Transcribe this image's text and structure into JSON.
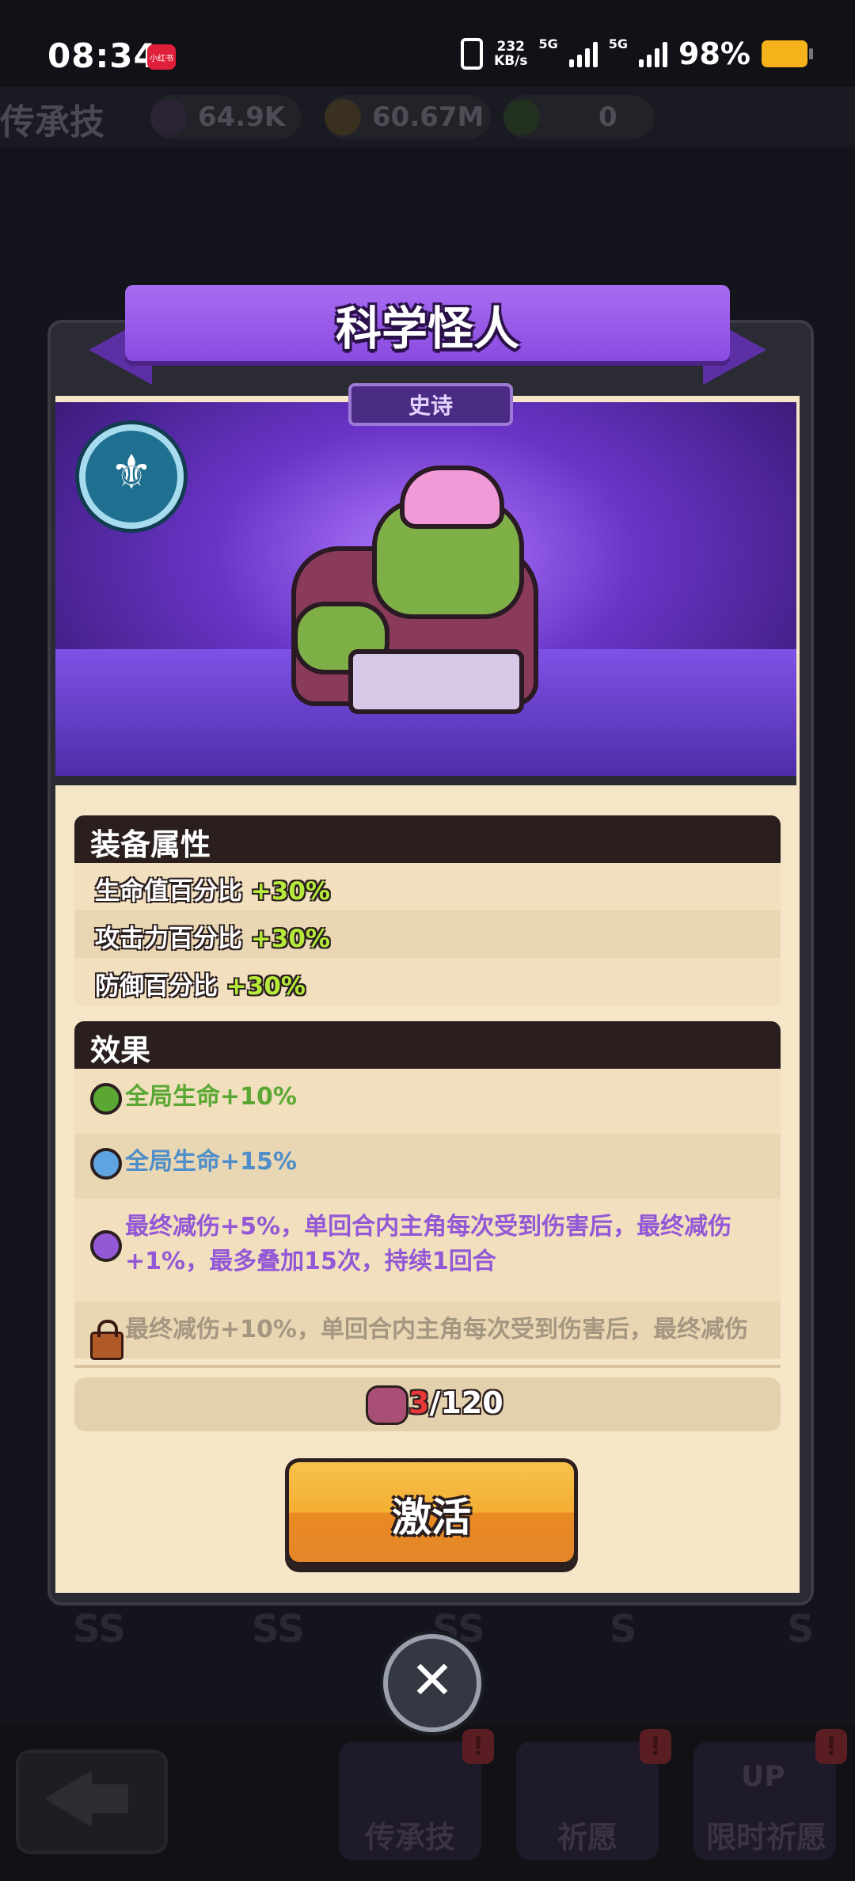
{
  "status_bar": {
    "time": "08:34",
    "app_badge": "小红书",
    "net_speed_value": "232",
    "net_speed_unit": "KB/s",
    "signal_1": "5G",
    "signal_2": "5G",
    "battery": "98%"
  },
  "resources": {
    "title": "传承技",
    "item_1": "64.9K",
    "item_2": "60.67M",
    "item_3": "0"
  },
  "modal": {
    "title": "科学怪人",
    "rarity": "史诗",
    "equip_section": "装备属性",
    "stats": [
      {
        "label": "生命值百分比 ",
        "value": "+30%"
      },
      {
        "label": "攻击力百分比 ",
        "value": "+30%"
      },
      {
        "label": "防御百分比 ",
        "value": "+30%"
      }
    ],
    "effect_section": "效果",
    "effects": [
      {
        "text": "全局生命+10%",
        "color": "#5aa833"
      },
      {
        "text": "全局生命+15%",
        "color": "#4f8ec9"
      },
      {
        "text": "最终减伤+5%，单回合内主角每次受到伤害后，最终减伤+1%，最多叠加15次，持续1回合",
        "color": "#9358d6"
      },
      {
        "text": "最终减伤+10%，单回合内主角每次受到伤害后，最终减伤",
        "color": "#a49782"
      }
    ],
    "progress_current": "3",
    "progress_total": "/120",
    "activate_label": "激活",
    "close_icon": "close-icon"
  },
  "bottom_nav": {
    "items": [
      "传承技",
      "祈愿",
      "限时祈愿"
    ],
    "badge": "!",
    "up_label": "UP"
  },
  "background_tags": [
    "SS",
    "SS",
    "SS",
    "S",
    "S"
  ]
}
